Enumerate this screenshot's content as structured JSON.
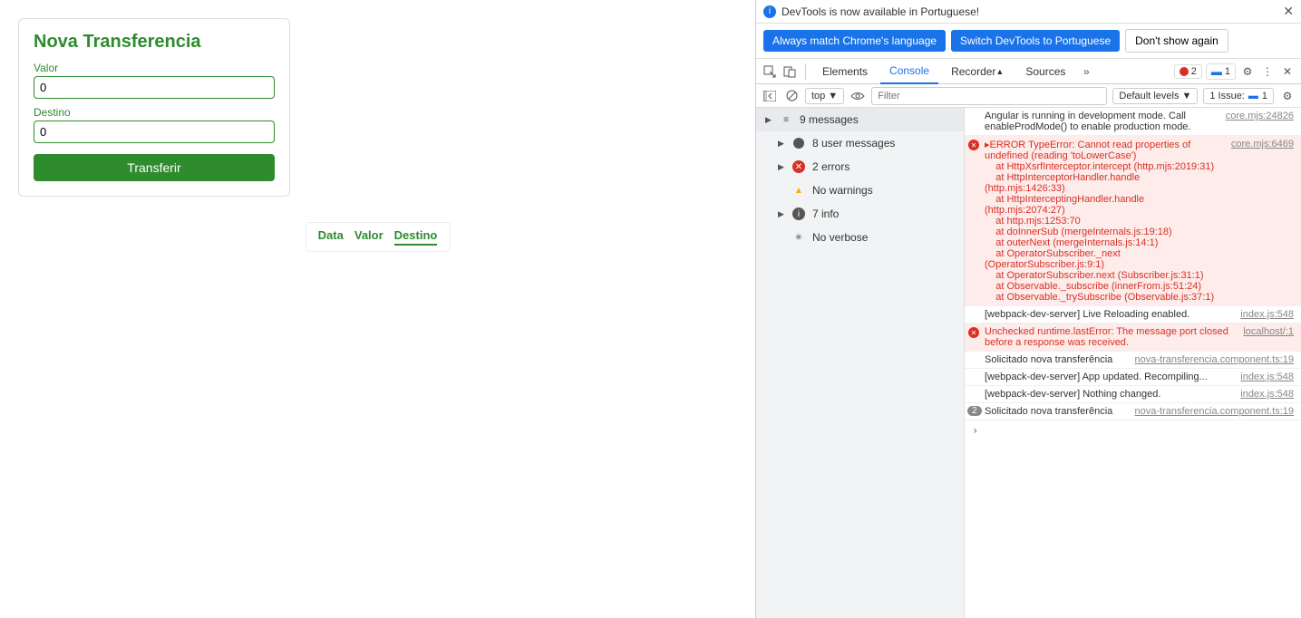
{
  "form": {
    "title": "Nova Transferencia",
    "valor_label": "Valor",
    "valor_value": "0",
    "destino_label": "Destino",
    "destino_value": "0",
    "submit": "Transferir"
  },
  "tabs": {
    "data": "Data",
    "valor": "Valor",
    "destino": "Destino"
  },
  "devtools": {
    "banner": "DevTools is now available in Portuguese!",
    "btn_match": "Always match Chrome's language",
    "btn_switch": "Switch DevTools to Portuguese",
    "btn_dont": "Don't show again",
    "tab_elements": "Elements",
    "tab_console": "Console",
    "tab_recorder": "Recorder",
    "tab_sources": "Sources",
    "err_count": "2",
    "msg_count": "1",
    "top_label": "top",
    "filter_placeholder": "Filter",
    "levels": "Default levels",
    "issues_label": "1 Issue:",
    "issues_count": "1"
  },
  "sidebar": {
    "messages": "9 messages",
    "user": "8 user messages",
    "errors": "2 errors",
    "warnings": "No warnings",
    "info": "7 info",
    "verbose": "No verbose"
  },
  "logs": {
    "row0_msg": "Angular is running in development mode. Call enableProdMode() to enable production mode.",
    "row0_src": "core.mjs:24826",
    "row1_msg": "▸ERROR TypeError: Cannot read properties of undefined (reading 'toLowerCase')\n    at HttpXsrfInterceptor.intercept (http.mjs:2019:31)\n    at HttpInterceptorHandler.handle (http.mjs:1426:33)\n    at HttpInterceptingHandler.handle (http.mjs:2074:27)\n    at http.mjs:1253:70\n    at doInnerSub (mergeInternals.js:19:18)\n    at outerNext (mergeInternals.js:14:1)\n    at OperatorSubscriber._next (OperatorSubscriber.js:9:1)\n    at OperatorSubscriber.next (Subscriber.js:31:1)\n    at Observable._subscribe (innerFrom.js:51:24)\n    at Observable._trySubscribe (Observable.js:37:1)",
    "row1_src": "core.mjs:6469",
    "row2_msg": "[webpack-dev-server] Live Reloading enabled.",
    "row2_src": "index.js:548",
    "row3_msg": "Unchecked runtime.lastError: The message port closed before a response was received.",
    "row3_src": "localhost/:1",
    "row4_msg": "Solicitado nova transferência",
    "row4_src": "nova-transferencia.component.ts:19",
    "row5_msg": "[webpack-dev-server] App updated. Recompiling...",
    "row5_src": "index.js:548",
    "row6_msg": "[webpack-dev-server] Nothing changed.",
    "row6_src": "index.js:548",
    "row7_count": "2",
    "row7_msg": "Solicitado nova transferência",
    "row7_src": "nova-transferencia.component.ts:19"
  }
}
